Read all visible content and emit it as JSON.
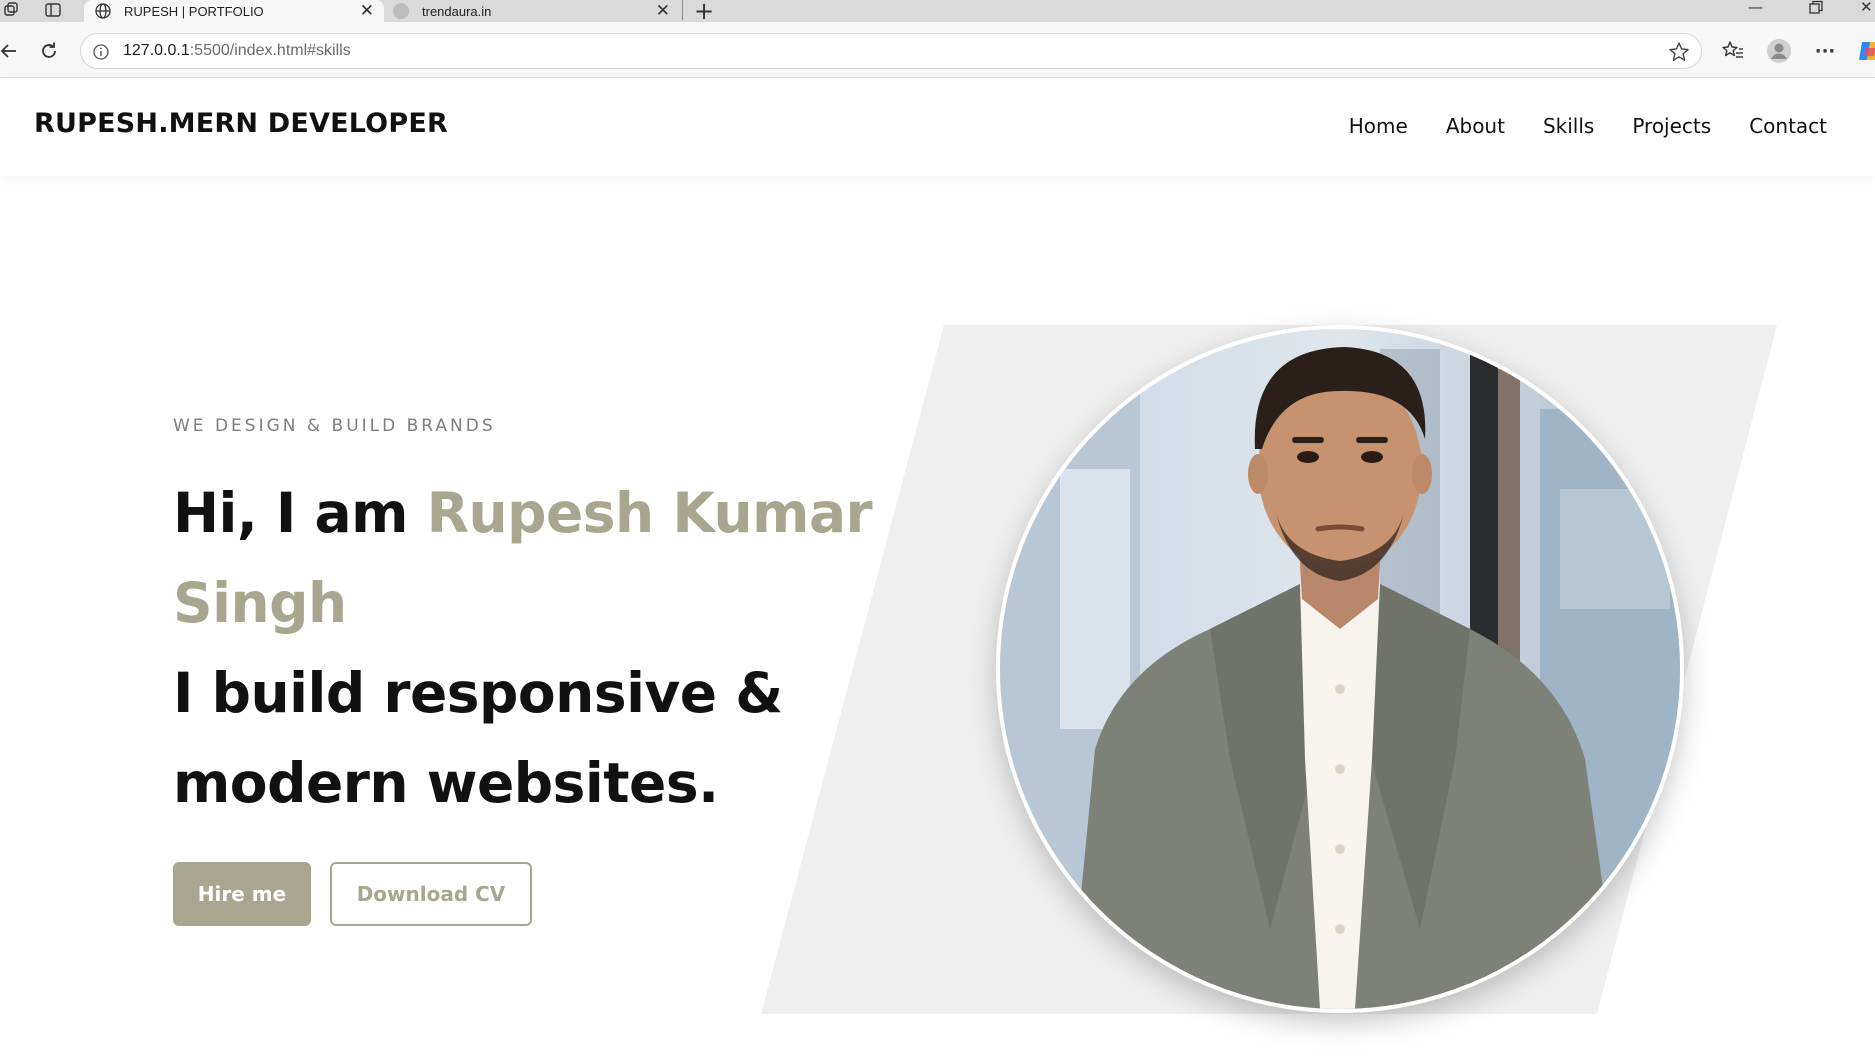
{
  "browser": {
    "tabs": [
      {
        "title": "RUPESH | PORTFOLIO",
        "active": true
      },
      {
        "title": "trendaura.in",
        "active": false
      }
    ],
    "url_host": "127.0.0.1",
    "url_rest": ":5500/index.html#skills"
  },
  "site": {
    "brand": "RUPESH.MERN DEVELOPER",
    "nav": [
      "Home",
      "About",
      "Skills",
      "Projects",
      "Contact"
    ]
  },
  "hero": {
    "eyebrow": "WE DESIGN & BUILD BRANDS",
    "greeting": "Hi, I am ",
    "name": "Rupesh Kumar Singh",
    "tagline": "I build responsive & modern websites.",
    "hire_label": "Hire me",
    "cv_label": "Download CV"
  },
  "colors": {
    "accent": "#a9a68f",
    "text": "#111111",
    "panel": "#efefef"
  }
}
